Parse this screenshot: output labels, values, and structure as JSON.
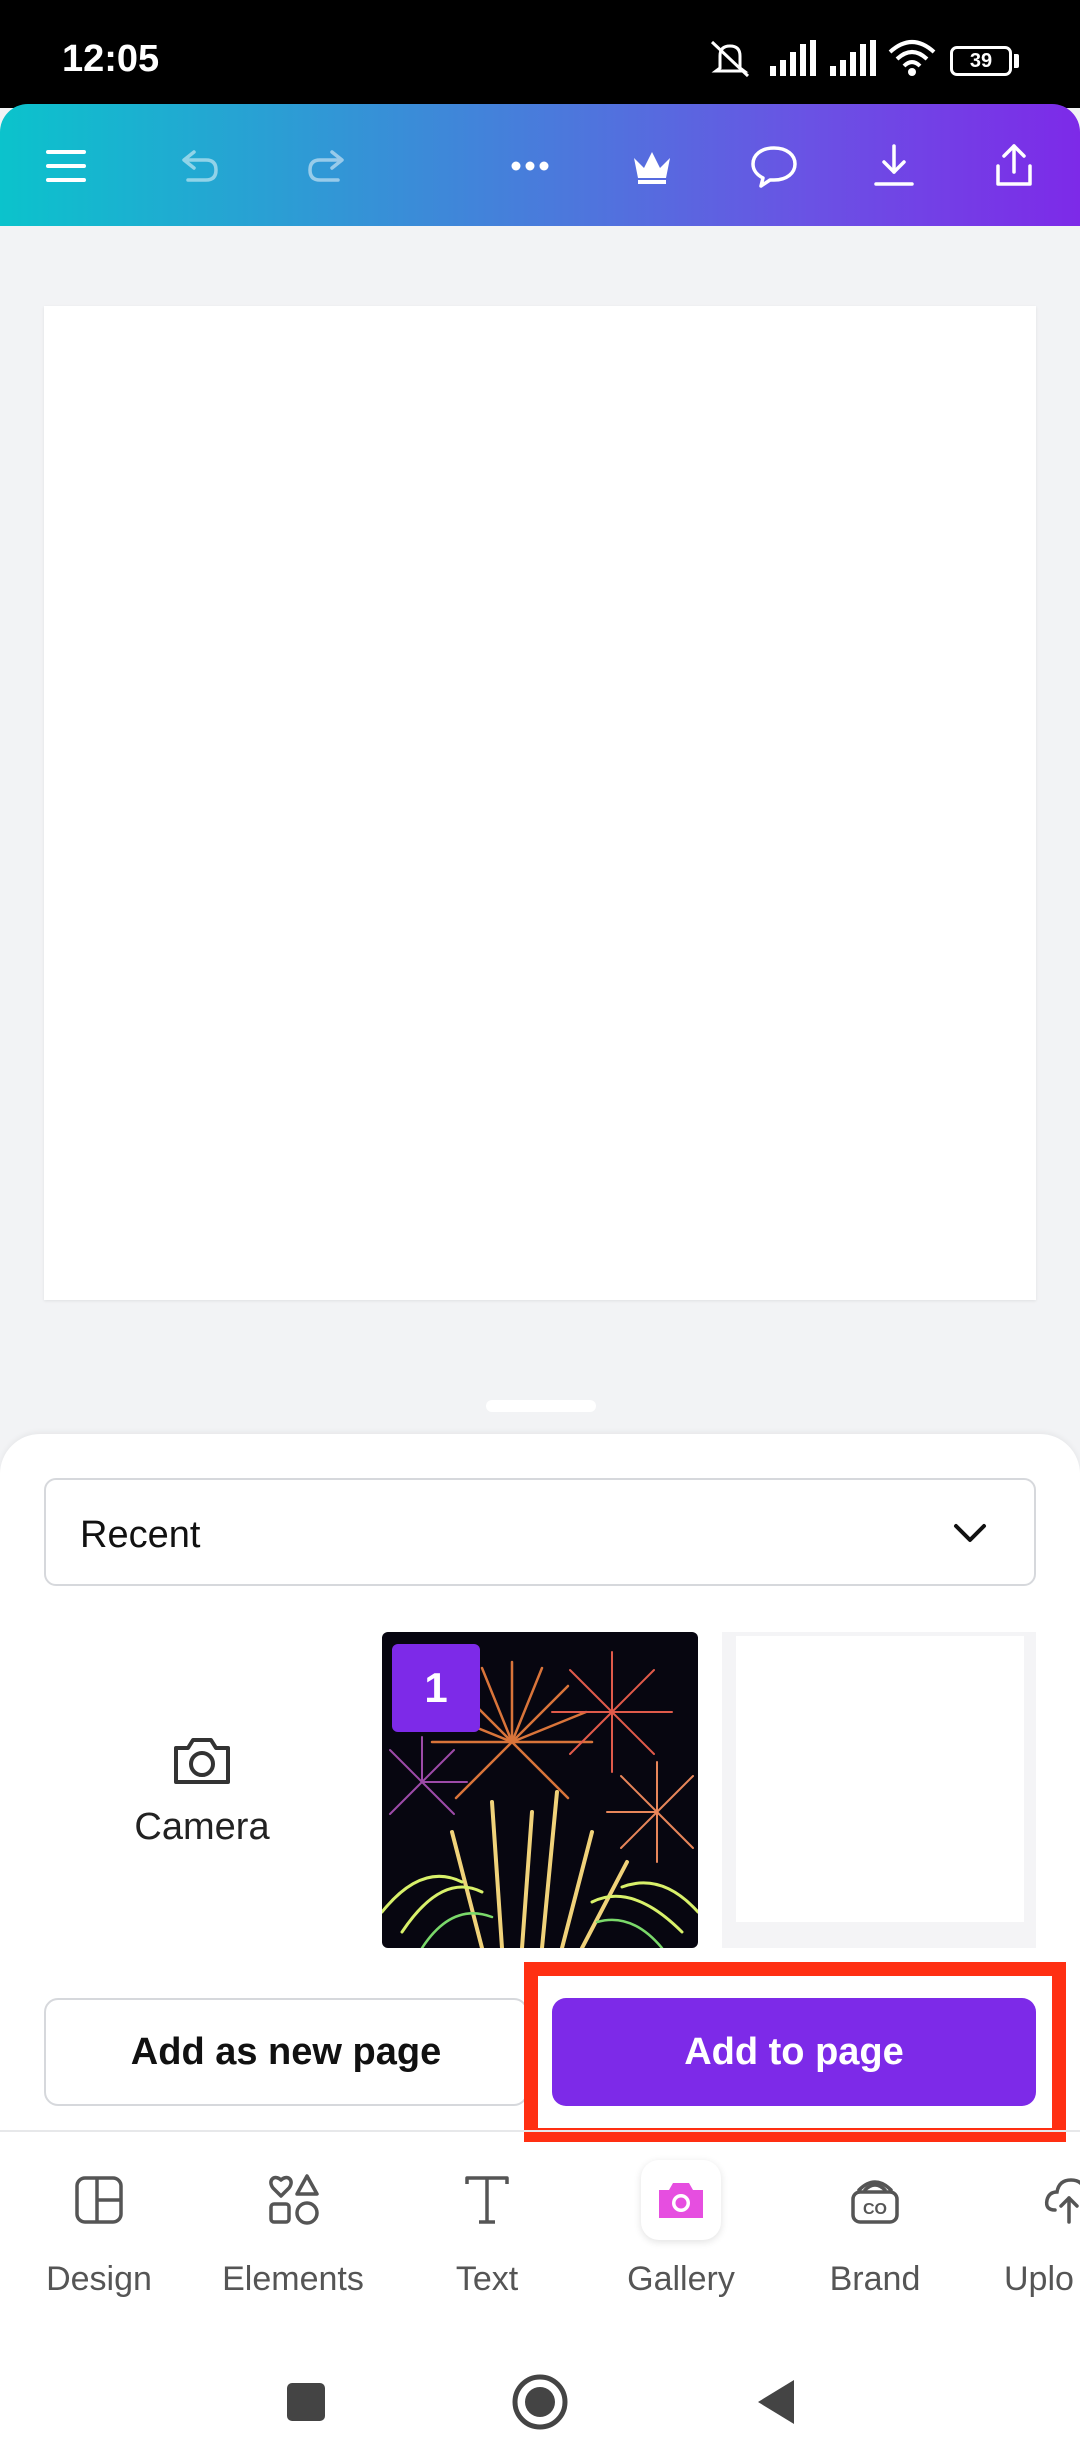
{
  "status_bar": {
    "time": "12:05",
    "battery": "39",
    "icons": [
      "mute-icon",
      "signal-icon",
      "signal-icon",
      "wifi-icon",
      "battery-icon"
    ]
  },
  "toolbar": {
    "icons": [
      "menu-icon",
      "undo-icon",
      "redo-icon",
      "more-icon",
      "crown-icon",
      "comment-icon",
      "download-icon",
      "share-icon"
    ]
  },
  "gallery_panel": {
    "album_selector": "Recent",
    "camera_label": "Camera",
    "selected_badge": "1"
  },
  "actions": {
    "add_as_new_page": "Add as new page",
    "add_to_page": "Add to page"
  },
  "bottom_tabs": [
    {
      "label": "Design",
      "icon": "design-icon"
    },
    {
      "label": "Elements",
      "icon": "elements-icon"
    },
    {
      "label": "Text",
      "icon": "text-icon"
    },
    {
      "label": "Gallery",
      "icon": "camera-icon",
      "active": true
    },
    {
      "label": "Brand",
      "icon": "brand-icon"
    },
    {
      "label": "Uplo",
      "icon": "upload-icon"
    }
  ],
  "colors": {
    "accent": "#7d2ae8",
    "highlight": "#ff2f12",
    "gallery_icon": "#e64ee0"
  }
}
